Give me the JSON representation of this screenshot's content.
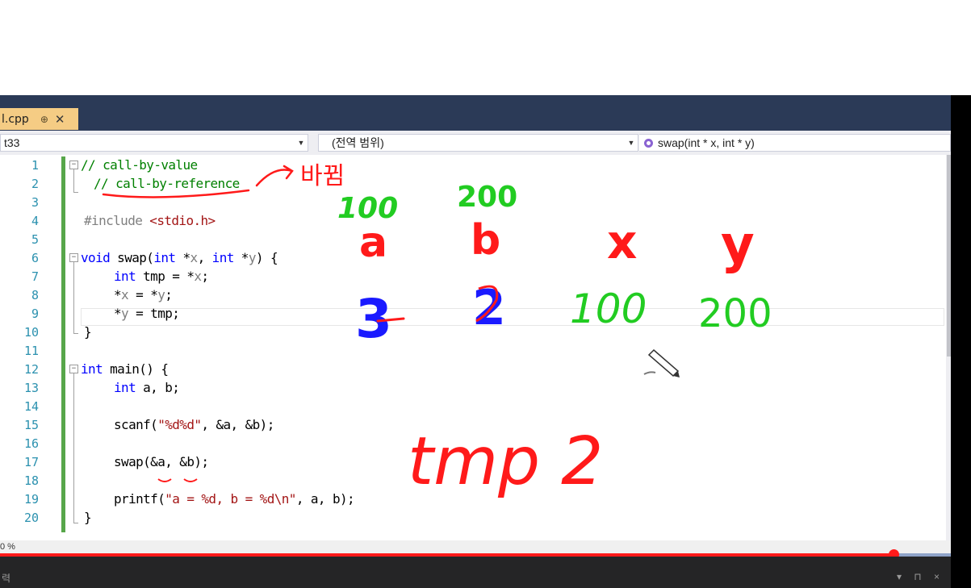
{
  "tab": {
    "filename": "l.cpp",
    "pin_glyph": "⊕",
    "close_glyph": "✕"
  },
  "navbar": {
    "project": "t33",
    "scope": "(전역 범위)",
    "member": "swap(int * x, int * y)"
  },
  "line_numbers": [
    "1",
    "2",
    "3",
    "4",
    "5",
    "6",
    "7",
    "8",
    "9",
    "10",
    "11",
    "12",
    "13",
    "14",
    "15",
    "16",
    "17",
    "18",
    "19",
    "20"
  ],
  "code": {
    "l1": "// call-by-value",
    "l2": "// call-by-reference",
    "l4_pre": "#include ",
    "l4_hdr": "<stdio.h>",
    "l6_kw": "void",
    "l6_a": " swap(",
    "l6_int1": "int",
    "l6_b": " *",
    "l6_x": "x",
    "l6_c": ", ",
    "l6_int2": "int",
    "l6_d": " *",
    "l6_y": "y",
    "l6_e": ") {",
    "l7_kw": "int",
    "l7_rest": " tmp = *",
    "l7_x": "x",
    "l7_end": ";",
    "l8_a": "*",
    "l8_x": "x",
    "l8_b": " = *",
    "l8_y": "y",
    "l8_end": ";",
    "l9_a": "*",
    "l9_y": "y",
    "l9_b": " = tmp;",
    "l10": "}",
    "l12_kw": "int",
    "l12_rest": " main() {",
    "l13_kw": "int",
    "l13_rest": " a, b;",
    "l15_a": "scanf(",
    "l15_str": "\"%d%d\"",
    "l15_b": ", &a, &b);",
    "l17": "swap(&a, &b);",
    "l19_a": "printf(",
    "l19_str": "\"a = %d, b = %d\\n\"",
    "l19_b": ", a, b);",
    "l20": "}"
  },
  "annotations": {
    "korean_note": "바뀜",
    "val_a": "100",
    "val_b": "200",
    "var_a": "a",
    "var_b": "b",
    "var_x": "x",
    "var_y": "y",
    "x_val": "100",
    "y_val": "200",
    "a_new": "3",
    "b_new": "2",
    "tmp_label": "tmp 2"
  },
  "zoom": "0 %",
  "playback_progress": 0.94,
  "status": {
    "left": "력",
    "right_icons": "▾ ⊓ ×"
  },
  "colors": {
    "ink_red": "#ff1a1a",
    "ink_green": "#22cc22",
    "ink_blue": "#1a1aff",
    "titlebar": "#2b3a57",
    "tab_active": "#f5cc84"
  }
}
